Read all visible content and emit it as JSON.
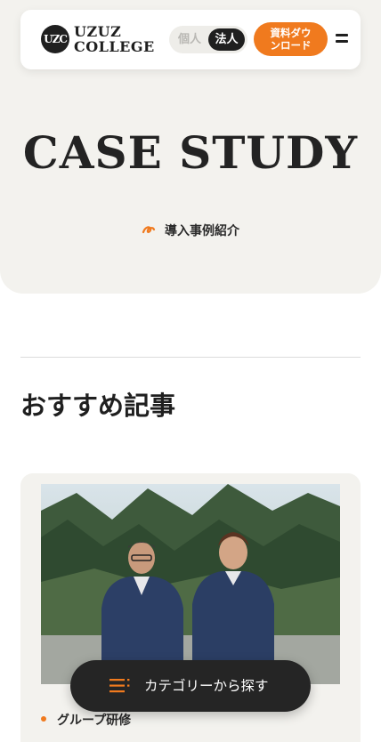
{
  "header": {
    "logo_mark": "UZC",
    "logo_line1": "UZUZ",
    "logo_line2": "COLLEGE",
    "toggle_personal": "個人",
    "toggle_corporate": "法人",
    "download_label_1": "資料ダウ",
    "download_label_2": "ンロード"
  },
  "hero": {
    "title": "CASE STUDY",
    "subtitle": "導入事例紹介"
  },
  "section": {
    "title": "おすすめ記事"
  },
  "card": {
    "tag": "グループ研修"
  },
  "category_button": {
    "label": "カテゴリーから探す"
  },
  "colors": {
    "accent": "#f07a1e",
    "dark": "#1f1f1f",
    "hero_bg": "#f3f2ee"
  },
  "icons": [
    "menu-icon",
    "pen-swoosh-icon",
    "list-icon"
  ]
}
